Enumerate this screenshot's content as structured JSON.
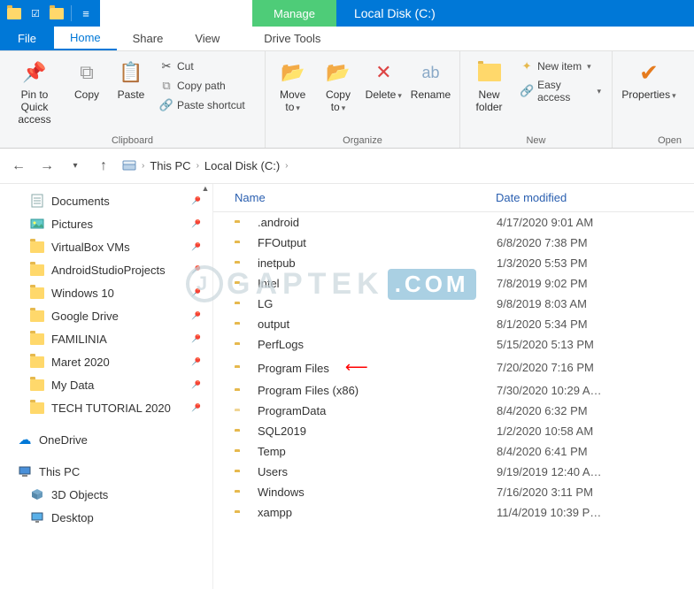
{
  "title": "Local Disk (C:)",
  "manage_tab": "Manage",
  "tabs": {
    "file": "File",
    "home": "Home",
    "share": "Share",
    "view": "View",
    "drive_tools": "Drive Tools"
  },
  "ribbon": {
    "clipboard": {
      "label": "Clipboard",
      "pin": "Pin to Quick access",
      "copy": "Copy",
      "paste": "Paste",
      "cut": "Cut",
      "copy_path": "Copy path",
      "paste_shortcut": "Paste shortcut"
    },
    "organize": {
      "label": "Organize",
      "move_to": "Move to",
      "copy_to": "Copy to",
      "delete": "Delete",
      "rename": "Rename"
    },
    "new": {
      "label": "New",
      "new_folder": "New folder",
      "new_item": "New item",
      "easy_access": "Easy access"
    },
    "open": {
      "label": "Open",
      "properties": "Properties"
    }
  },
  "breadcrumb": {
    "this_pc": "This PC",
    "drive": "Local Disk (C:)"
  },
  "sidebar": [
    {
      "name": "Documents",
      "icon": "doc",
      "pin": true,
      "lvl": 1
    },
    {
      "name": "Pictures",
      "icon": "pic",
      "pin": true,
      "lvl": 1
    },
    {
      "name": "VirtualBox VMs",
      "icon": "folder",
      "pin": true,
      "lvl": 1
    },
    {
      "name": "AndroidStudioProjects",
      "icon": "folder",
      "pin": true,
      "lvl": 1
    },
    {
      "name": "Windows 10",
      "icon": "folder",
      "pin": true,
      "lvl": 1
    },
    {
      "name": "Google Drive",
      "icon": "folder",
      "pin": true,
      "lvl": 1
    },
    {
      "name": "FAMILINIA",
      "icon": "folder",
      "pin": true,
      "lvl": 1
    },
    {
      "name": "Maret 2020",
      "icon": "folder",
      "pin": true,
      "lvl": 1
    },
    {
      "name": "My Data",
      "icon": "folder",
      "pin": true,
      "lvl": 1
    },
    {
      "name": "TECH TUTORIAL 2020",
      "icon": "folder",
      "pin": true,
      "lvl": 1
    },
    {
      "name": "",
      "spacer": true
    },
    {
      "name": "OneDrive",
      "icon": "cloud",
      "lvl": 0
    },
    {
      "name": "",
      "spacer": true
    },
    {
      "name": "This PC",
      "icon": "pc",
      "lvl": 0
    },
    {
      "name": "3D Objects",
      "icon": "3d",
      "lvl": 1
    },
    {
      "name": "Desktop",
      "icon": "desktop",
      "lvl": 1
    }
  ],
  "columns": {
    "name": "Name",
    "date": "Date modified"
  },
  "files": [
    {
      "name": ".android",
      "date": "4/17/2020 9:01 AM"
    },
    {
      "name": "FFOutput",
      "date": "6/8/2020 7:38 PM"
    },
    {
      "name": "inetpub",
      "date": "1/3/2020 5:53 PM"
    },
    {
      "name": "Intel",
      "date": "7/8/2019 9:02 PM"
    },
    {
      "name": "LG",
      "date": "9/8/2019 8:03 AM"
    },
    {
      "name": "output",
      "date": "8/1/2020 5:34 PM"
    },
    {
      "name": "PerfLogs",
      "date": "5/15/2020 5:13 PM"
    },
    {
      "name": "Program Files",
      "date": "7/20/2020 7:16 PM",
      "arrow": true
    },
    {
      "name": "Program Files (x86)",
      "date": "7/30/2020 10:29 A…"
    },
    {
      "name": "ProgramData",
      "date": "8/4/2020 6:32 PM",
      "faded": true
    },
    {
      "name": "SQL2019",
      "date": "1/2/2020 10:58 AM"
    },
    {
      "name": "Temp",
      "date": "8/4/2020 6:41 PM"
    },
    {
      "name": "Users",
      "date": "9/19/2019 12:40 A…"
    },
    {
      "name": "Windows",
      "date": "7/16/2020 3:11 PM"
    },
    {
      "name": "xampp",
      "date": "11/4/2019 10:39 P…"
    }
  ],
  "watermark": {
    "text": "GAPTEK",
    "suffix": ".COM"
  }
}
